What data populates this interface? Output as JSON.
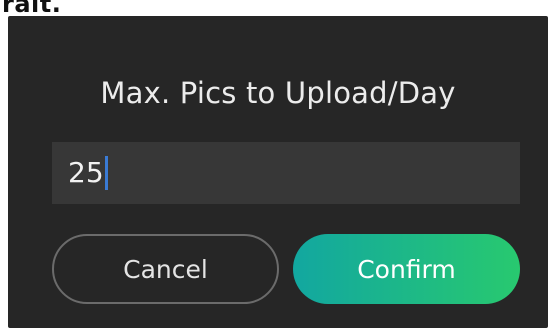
{
  "header_fragment": "rait.",
  "dialog": {
    "title": "Max. Pics to Upload/Day",
    "input": {
      "value": "25"
    },
    "buttons": {
      "cancel_label": "Cancel",
      "confirm_label": "Confirm"
    }
  },
  "colors": {
    "dialog_bg": "#262626",
    "input_bg": "#373737",
    "caret": "#3a7bd5",
    "confirm_gradient_start": "#12a7a0",
    "confirm_gradient_end": "#28c96f"
  }
}
